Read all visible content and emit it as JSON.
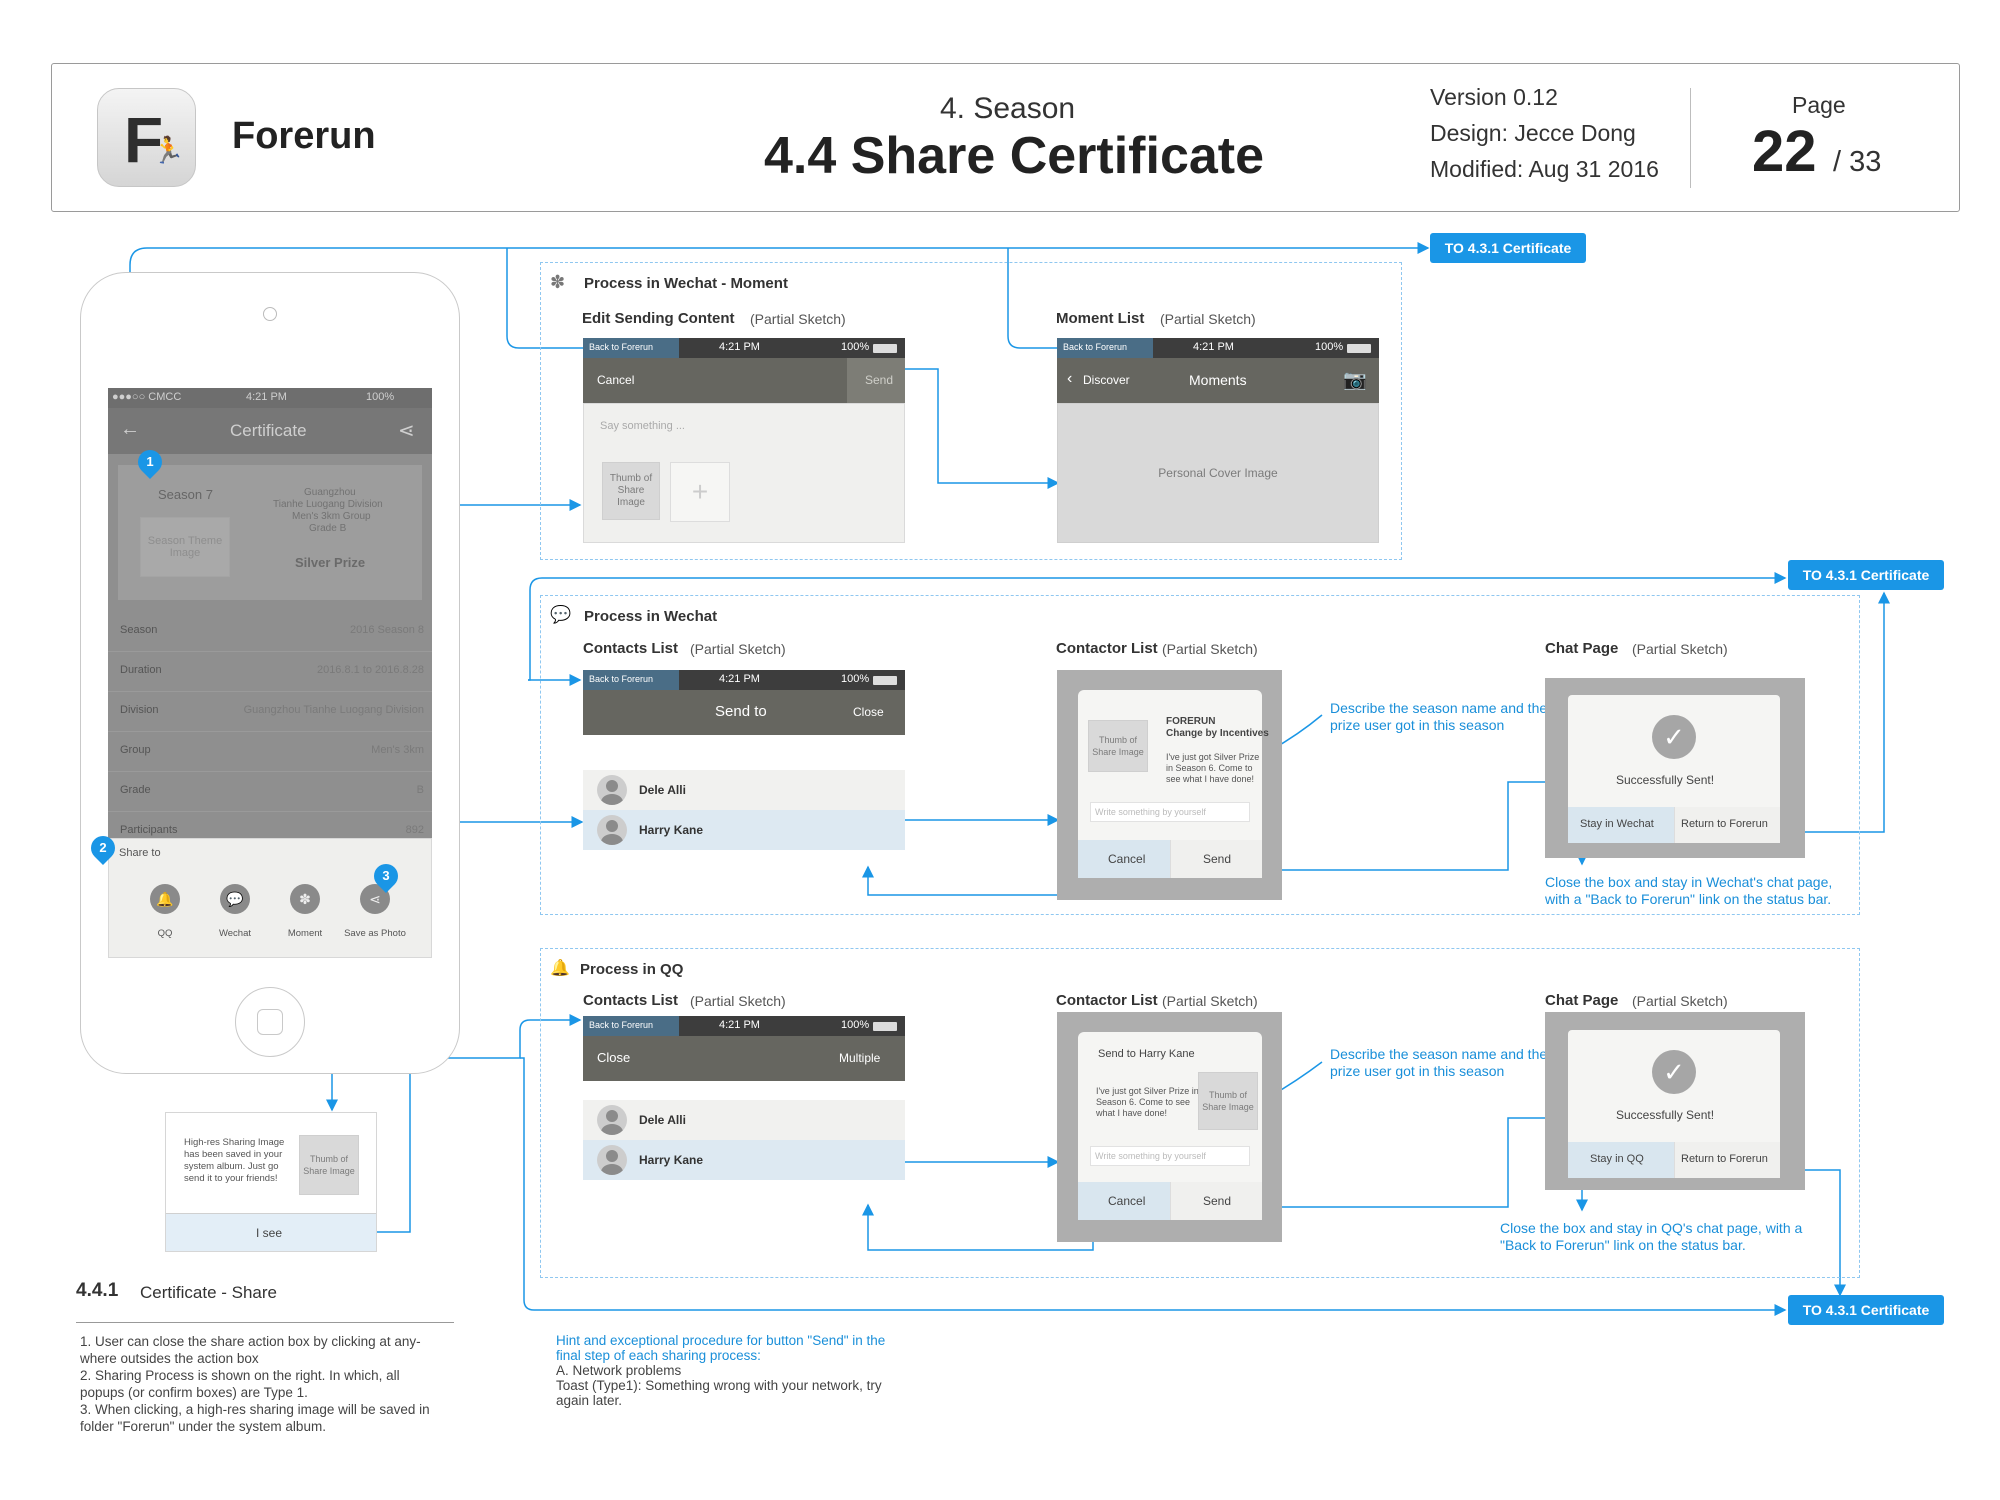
{
  "header": {
    "app_name": "Forerun",
    "app_icon_letter": "F",
    "section": "4. Season",
    "title": "4.4 Share Certificate",
    "version": "Version 0.12",
    "design": "Design: Jecce Dong",
    "modified": "Modified: Aug 31 2016",
    "page_label": "Page",
    "page_current": "22",
    "page_total": "/ 33"
  },
  "links": {
    "to_certificate": "TO 4.3.1 Certificate"
  },
  "phone": {
    "status_carrier": "●●●○○ CMCC",
    "status_time": "4:21 PM",
    "status_battery": "100%",
    "nav_title": "Certificate",
    "season_label": "Season 7",
    "season_theme": "Season Theme Image",
    "city": "Guangzhou",
    "division": "Tianhe Luogang Division",
    "group": "Men's 3km Group",
    "grade": "Grade B",
    "prize": "Silver Prize",
    "rows": [
      {
        "label": "Season",
        "value": "2016 Season 8"
      },
      {
        "label": "Duration",
        "value": "2016.8.1 to 2016.8.28"
      },
      {
        "label": "Division",
        "value": "Guangzhou Tianhe Luogang Division"
      },
      {
        "label": "Group",
        "value": "Men's 3km"
      },
      {
        "label": "Grade",
        "value": "B"
      },
      {
        "label": "Participants",
        "value": "892"
      }
    ],
    "share_to": "Share to",
    "share_options": [
      "QQ",
      "Wechat",
      "Moment",
      "Save as Photo"
    ],
    "pins": [
      "1",
      "2",
      "3"
    ]
  },
  "save_popup": {
    "message": "High-res Sharing Image has been saved in your system album. Just go send it to your friends!",
    "thumb": "Thumb of Share Image",
    "button": "I see"
  },
  "footer": {
    "number": "4.4.1",
    "title": "Certificate - Share",
    "notes": [
      "1. User can close the share action box by clicking at any-",
      "where outsides the action box",
      "2. Sharing Process is shown on the right. In which, all",
      "popups (or confirm boxes) are Type 1.",
      "3. When clicking, a high-res sharing image will be saved in",
      "folder \"Forerun\" under the system album."
    ],
    "hint_lines": [
      "Hint and exceptional procedure for button \"Send\" in the",
      "final step of each sharing process:"
    ],
    "hint_body": [
      "A. Network problems",
      "Toast (Type1): Something wrong with your network, try",
      "again later."
    ]
  },
  "partial_sketch": "(Partial Sketch)",
  "status": {
    "back": "Back to Forerun",
    "time": "4:21 PM",
    "battery": "100%"
  },
  "moment": {
    "section_title": "Process in Wechat - Moment",
    "edit_title": "Edit Sending Content",
    "cancel": "Cancel",
    "send": "Send",
    "placeholder": "Say something ...",
    "thumb": "Thumb of Share Image",
    "plus": "+",
    "list_title": "Moment List",
    "discover": "Discover",
    "moments": "Moments",
    "cover": "Personal Cover Image"
  },
  "wechat": {
    "section_title": "Process in Wechat",
    "contacts_title": "Contacts List",
    "send_to": "Send to",
    "close": "Close",
    "contacts": [
      "Dele Alli",
      "Harry Kane"
    ],
    "contactor_title": "Contactor List",
    "thumb": "Thumb of Share Image",
    "brand": "FORERUN",
    "tagline": "Change by Incentives",
    "message": "I've just got Silver Prize in Season 6. Come to see what I have done!",
    "write": "Write something by yourself",
    "cancel": "Cancel",
    "send": "Send",
    "describe": "Describe the season name and the prize user got in this season",
    "chat_title": "Chat Page",
    "success": "Successfully Sent!",
    "stay": "Stay in Wechat",
    "return": "Return to Forerun",
    "close_note": "Close the box and stay in Wechat's chat page, with a \"Back to Forerun\" link on the status bar."
  },
  "qq": {
    "section_title": "Process in QQ",
    "contacts_title": "Contacts List",
    "close": "Close",
    "multiple": "Multiple",
    "contacts": [
      "Dele Alli",
      "Harry Kane"
    ],
    "contactor_title": "Contactor List",
    "send_to": "Send to Harry Kane",
    "message": "I've just got Silver Prize in Season 6. Come to see what I have done!",
    "thumb": "Thumb of Share Image",
    "write": "Write something by yourself",
    "cancel": "Cancel",
    "send": "Send",
    "describe": "Describe the season name and the prize user got in this season",
    "chat_title": "Chat Page",
    "success": "Successfully Sent!",
    "stay": "Stay in QQ",
    "return": "Return to Forerun",
    "close_note": "Close the box and stay in QQ's chat page, with a \"Back to Forerun\" link on the status bar."
  },
  "colors": {
    "accent": "#1a96e6",
    "dark_bar": "#666660",
    "status_bar": "#3d3d3d",
    "overlay": "#8f8f8f"
  }
}
